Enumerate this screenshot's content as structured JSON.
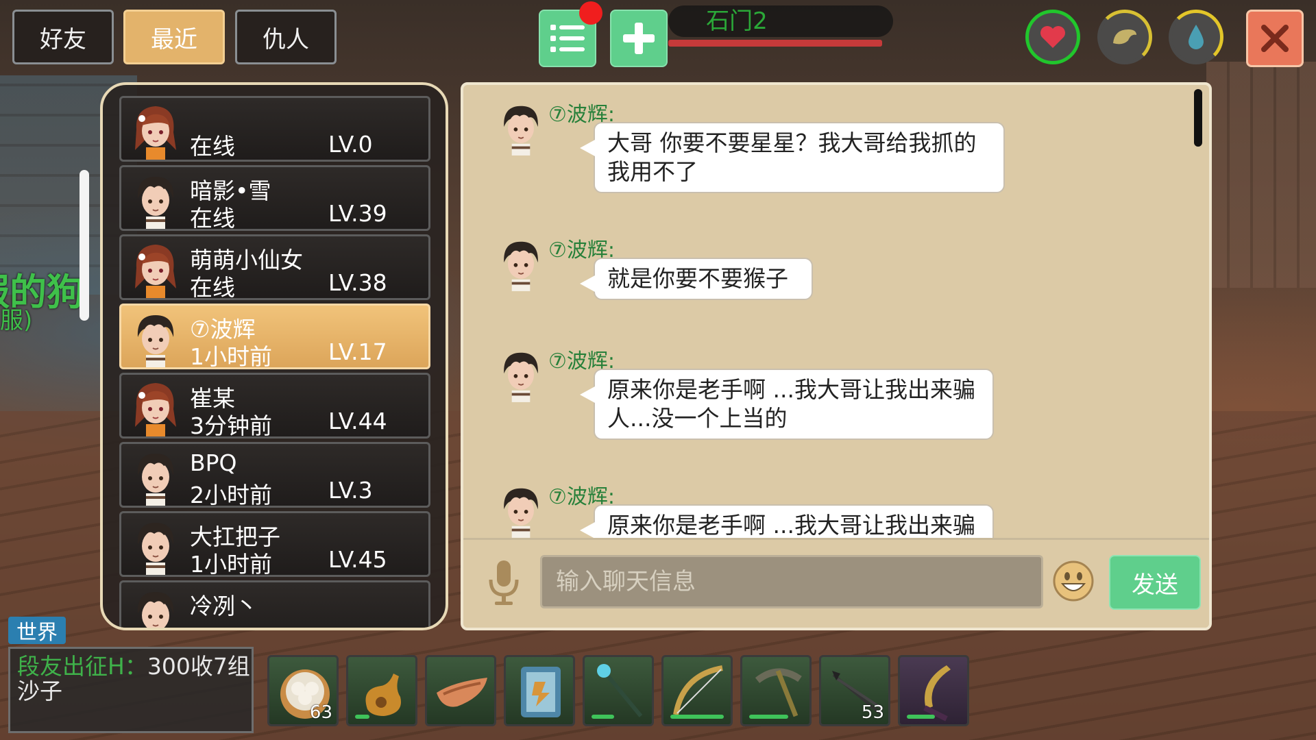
{
  "tabs": [
    {
      "label": "好友",
      "active": false
    },
    {
      "label": "最近",
      "active": true
    },
    {
      "label": "仇人",
      "active": false
    }
  ],
  "location": "石门2",
  "background_world_name": "服的狗",
  "background_world_sub": "服)",
  "status_icons": [
    "heart-icon",
    "food-icon",
    "water-drop-icon"
  ],
  "friends": [
    {
      "name": "",
      "status": "在线",
      "level": "LV.0",
      "avatar": "girl"
    },
    {
      "name": "暗影•雪",
      "status": "在线",
      "level": "LV.39",
      "avatar": "boy"
    },
    {
      "name": "萌萌小仙女",
      "status": "在线",
      "level": "LV.38",
      "avatar": "girl"
    },
    {
      "name": "⑦波辉",
      "status": "1小时前",
      "level": "LV.17",
      "avatar": "boy",
      "selected": true
    },
    {
      "name": "崔某",
      "status": "3分钟前",
      "level": "LV.44",
      "avatar": "girl"
    },
    {
      "name": "BPQ",
      "status": "2小时前",
      "level": "LV.3",
      "avatar": "boy"
    },
    {
      "name": "大扛把子",
      "status": "1小时前",
      "level": "LV.45",
      "avatar": "boy"
    },
    {
      "name": "冷冽丶",
      "status": "",
      "level": "",
      "avatar": "boy"
    }
  ],
  "messages": [
    {
      "sender": "⑦波辉:",
      "text": "大哥 你要不要星星？我大哥给我抓的我用不了"
    },
    {
      "sender": "⑦波辉:",
      "text": "就是你要不要猴子"
    },
    {
      "sender": "⑦波辉:",
      "text": "原来你是老手啊 ...我大哥让我出来骗人...没一个上当的"
    },
    {
      "sender": "⑦波辉:",
      "text": "原来你是老手啊 ...我大哥让我出来骗"
    }
  ],
  "chat_input": {
    "placeholder": "输入聊天信息",
    "value": ""
  },
  "send_label": "发送",
  "world_chat": {
    "tag": "世界",
    "sender": "段友出征H：",
    "message": "300收7组沙子"
  },
  "hotbar": [
    {
      "item": "dumplings-icon",
      "count": "63"
    },
    {
      "item": "gourd-icon",
      "count": "",
      "durability": 0.25
    },
    {
      "item": "boat-icon",
      "count": ""
    },
    {
      "item": "scroll-icon",
      "count": ""
    },
    {
      "item": "staff-icon",
      "count": "",
      "durability": 0.4
    },
    {
      "item": "bow-icon",
      "count": "",
      "durability": 0.95
    },
    {
      "item": "pickaxe-icon",
      "count": "",
      "durability": 0.7
    },
    {
      "item": "arrow-icon",
      "count": "53"
    },
    {
      "item": "blade-icon",
      "count": "",
      "durability": 0.5
    }
  ]
}
